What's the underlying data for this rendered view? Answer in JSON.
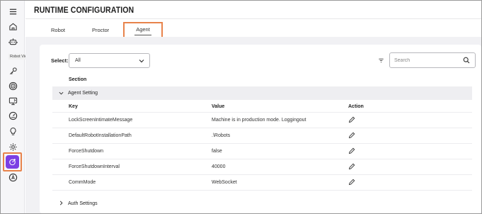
{
  "page": {
    "title": "RUNTIME CONFIGURATION"
  },
  "sidebar": {
    "tooltip": "Robot View",
    "items": [
      {
        "icon": "hamburger-menu-icon"
      },
      {
        "icon": "home-icon"
      },
      {
        "icon": "robot-icon"
      },
      {
        "icon": "key-icon"
      },
      {
        "icon": "target-icon"
      },
      {
        "icon": "screen-share-icon"
      },
      {
        "icon": "dashboard-gauge-icon"
      },
      {
        "icon": "lightbulb-icon"
      },
      {
        "icon": "gear-icon"
      },
      {
        "icon": "runtime-config-icon",
        "active": true
      },
      {
        "icon": "time-account-icon"
      }
    ],
    "active_color": "#7b3fe4"
  },
  "tabs": {
    "items": [
      "Robot",
      "Proctor",
      "Agent"
    ],
    "selected": "Agent"
  },
  "filters": {
    "select_label": "Select:",
    "select_value": "All",
    "search_placeholder": "Search"
  },
  "table": {
    "section_header": "Section",
    "group": {
      "label": "Agent Setting",
      "expanded": true
    },
    "columns": {
      "key": "Key",
      "value": "Value",
      "action": "Action"
    },
    "rows": [
      {
        "key": "LockScreenIntimateMessage",
        "value": "Machine is in production mode. Loggingout"
      },
      {
        "key": "DefaultRobotInstallationPath",
        "value": ".\\Robots"
      },
      {
        "key": "ForceShutdown",
        "value": "false"
      },
      {
        "key": "ForceShutdownInterval",
        "value": "40000"
      },
      {
        "key": "CommMode",
        "value": "WebSocket"
      }
    ],
    "collapsed_group": {
      "label": "Auth Settings",
      "expanded": false
    }
  },
  "colors": {
    "highlight_border": "#e8834b",
    "accent": "#7b3fe4"
  }
}
